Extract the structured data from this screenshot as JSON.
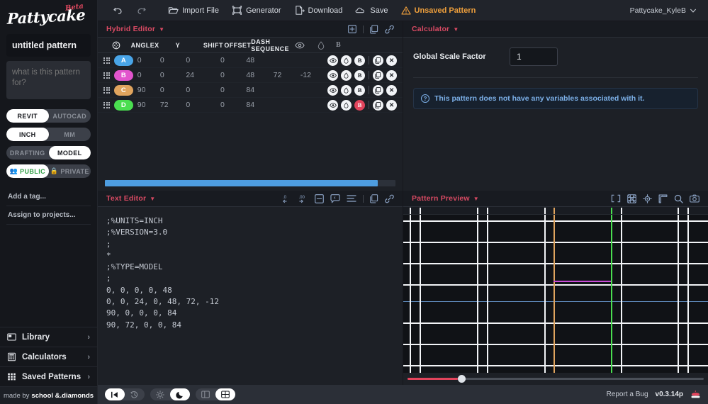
{
  "brand": {
    "name": "Pattycake",
    "badge": "Beta"
  },
  "sidebar": {
    "pattern_title": "untitled pattern",
    "pattern_title_placeholder": "untitled pattern",
    "description_placeholder": "what is this pattern for?",
    "description_value": "",
    "toggles": [
      {
        "name": "platform",
        "left": "REVIT",
        "right": "AUTOCAD",
        "selected": "REVIT"
      },
      {
        "name": "units",
        "left": "INCH",
        "right": "MM",
        "selected": "INCH"
      },
      {
        "name": "pattern-type",
        "left": "DRAFTING",
        "right": "MODEL",
        "selected": "MODEL"
      },
      {
        "name": "visibility",
        "left": "PUBLIC",
        "right": "PRIVATE",
        "selected": "PUBLIC",
        "left_icon": "group-icon",
        "right_icon": "lock-icon"
      }
    ],
    "add_tag": "Add a tag...",
    "assign_projects": "Assign to projects...",
    "nav": [
      {
        "label": "Library",
        "icon": "library-icon",
        "chevron": "›"
      },
      {
        "label": "Calculators",
        "icon": "calculator-icon",
        "chevron": "›"
      },
      {
        "label": "Saved Patterns",
        "icon": "grid-icon",
        "chevron": "›"
      }
    ],
    "made_by_prefix": "made by",
    "made_by": "school &.diamonds"
  },
  "toolbar": {
    "undo_icon": "undo-icon",
    "redo_icon": "redo-icon",
    "import_label": "Import File",
    "generator_label": "Generator",
    "download_label": "Download",
    "save_label": "Save",
    "unsaved_label": "Unsaved Pattern",
    "account": "Pattycake_KyleB"
  },
  "hybrid_editor": {
    "title": "Hybrid Editor",
    "columns": [
      "",
      "ANGLE",
      "X",
      "Y",
      "SHIFT",
      "OFFSET",
      "DASH SEQUENCE"
    ],
    "rows": [
      {
        "chip": "A",
        "chip_color": "#49a5e8",
        "angle": "0",
        "x": "0",
        "y": "0",
        "shift": "0",
        "offset": "48",
        "dash1": "",
        "dash2": "",
        "bold_active": false
      },
      {
        "chip": "B",
        "chip_color": "#e254cd",
        "angle": "0",
        "x": "0",
        "y": "24",
        "shift": "0",
        "offset": "48",
        "dash1": "72",
        "dash2": "-12",
        "bold_active": false
      },
      {
        "chip": "C",
        "chip_color": "#e0a45e",
        "angle": "90",
        "x": "0",
        "y": "0",
        "shift": "0",
        "offset": "84",
        "dash1": "",
        "dash2": "",
        "bold_active": false
      },
      {
        "chip": "D",
        "chip_color": "#4ade50",
        "angle": "90",
        "x": "72",
        "y": "0",
        "shift": "0",
        "offset": "84",
        "dash1": "",
        "dash2": "",
        "bold_active": true
      }
    ],
    "row_actions": {
      "eye": "eye-icon",
      "drop": "droplet-icon",
      "bold": "B",
      "copy": "copy-icon",
      "close": "✕"
    },
    "head_tools": [
      "add-row-icon",
      "duplicate-icon",
      "link-icon"
    ]
  },
  "calculator": {
    "title": "Calculator",
    "global_scale_label": "Global Scale Factor",
    "global_scale_value": "1",
    "note": "This pattern does not have any variables associated with it."
  },
  "text_editor": {
    "title": "Text Editor",
    "tools": [
      "decrease-decimal-icon",
      "increase-decimal-icon",
      "collapse-icon",
      "comment-icon",
      "format-icon",
      "copy-icon",
      "link-icon"
    ],
    "content": ";%UNITS=INCH\n;%VERSION=3.0\n;\n*\n;%TYPE=MODEL\n;\n0, 0, 0, 0, 48\n0, 0, 24, 0, 48, 72, -12\n90, 0, 0, 0, 84\n90, 72, 0, 0, 84"
  },
  "pattern_preview": {
    "title": "Pattern Preview",
    "tools": [
      "fit-icon",
      "pattern-icon",
      "target-icon",
      "measure-icon",
      "zoom-icon",
      "camera-icon"
    ],
    "zoom_value": 17
  },
  "bottombar": {
    "segments": [
      {
        "name": "reset-view",
        "items": [
          "❙◀",
          "↺"
        ],
        "selected": 0
      },
      {
        "name": "theme",
        "items": [
          "☀",
          "☾"
        ],
        "selected": 1
      },
      {
        "name": "layout",
        "items": [
          "▣",
          "⊞"
        ],
        "selected": 1
      }
    ],
    "report_bug": "Report a Bug",
    "version": "v0.3.14p",
    "logo_icon": "cake-icon"
  },
  "colors": {
    "accent_red": "#d94a63",
    "warning": "#f0a03c",
    "info_blue": "#7cb0e8",
    "scroll_blue": "#4e9de0"
  },
  "chart_data": {
    "type": "line",
    "title": "Pattern Preview",
    "vertical_lines": [
      {
        "x_pct": 2.0,
        "color": "#f2f4f7"
      },
      {
        "x_pct": 5.3,
        "color": "#f2f4f7"
      },
      {
        "x_pct": 24.3,
        "color": "#f2f4f7"
      },
      {
        "x_pct": 27.4,
        "color": "#f2f4f7"
      },
      {
        "x_pct": 46.3,
        "color": "#f2f4f7"
      },
      {
        "x_pct": 49.4,
        "color": "#e0a45e"
      },
      {
        "x_pct": 68.2,
        "color": "#4ade50"
      },
      {
        "x_pct": 71.3,
        "color": "#f2f4f7"
      },
      {
        "x_pct": 90.1,
        "color": "#f2f4f7"
      },
      {
        "x_pct": 93.2,
        "color": "#f2f4f7"
      }
    ],
    "horizontal_lines": [
      {
        "y_pct": 3.5,
        "color": "#f2f4f7"
      },
      {
        "y_pct": 17.0,
        "color": "#f2f4f7"
      },
      {
        "y_pct": 30.5,
        "color": "#f2f4f7"
      },
      {
        "y_pct": 44.0,
        "color": "#f2f4f7"
      },
      {
        "y_pct": 54.5,
        "color": "#6d9fd6"
      },
      {
        "y_pct": 68.0,
        "color": "#f2f4f7"
      },
      {
        "y_pct": 81.5,
        "color": "#f2f4f7"
      },
      {
        "y_pct": 95.0,
        "color": "#f2f4f7"
      }
    ],
    "segments": [
      {
        "x1_pct": 49.4,
        "x2_pct": 68.2,
        "y_pct": 41.5,
        "color": "#c84bd6"
      }
    ]
  }
}
